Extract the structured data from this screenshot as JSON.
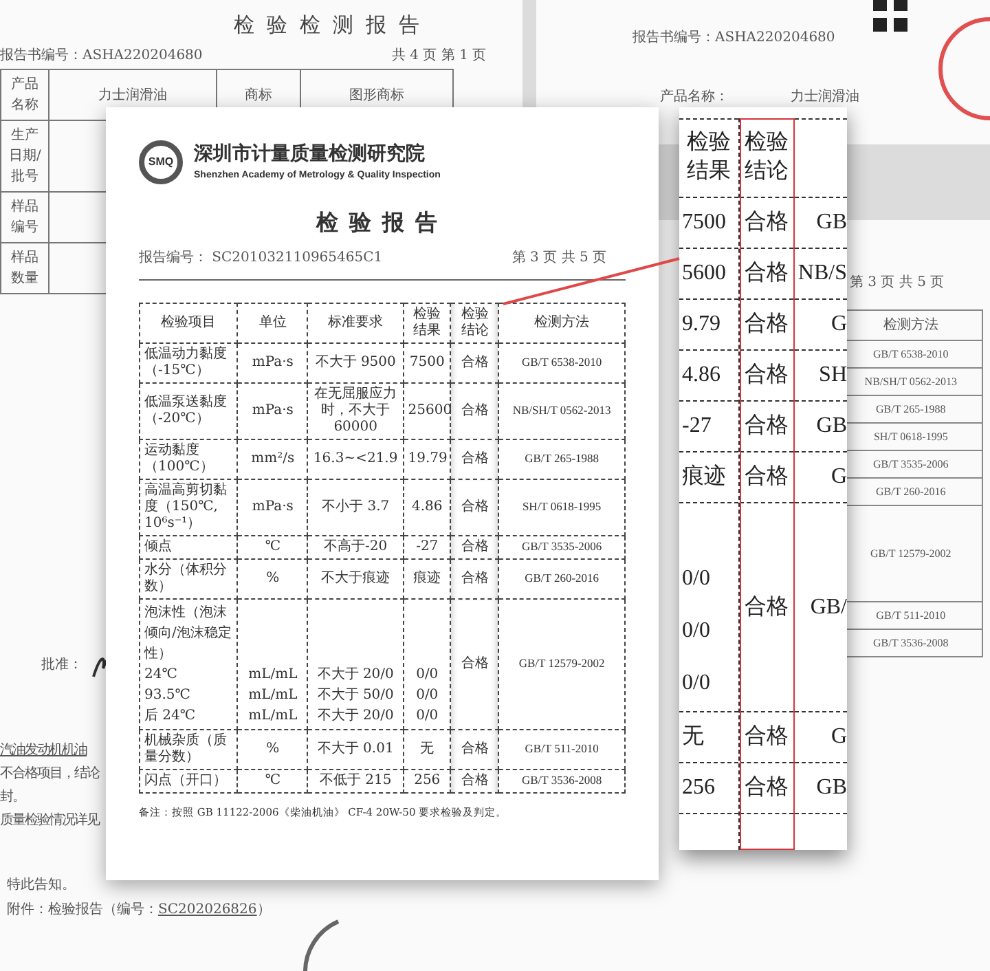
{
  "background_documents": {
    "top_left": {
      "title": "检验检测报告",
      "report_number": "报告书编号：ASHA220204680",
      "page_info": "共 4 页 第 1 页",
      "header_cells": [
        "产品名称",
        "力士润滑油",
        "商标",
        "图形商标"
      ],
      "row_labels": [
        "生产日期/批号",
        "样品编号",
        "样品数量"
      ]
    },
    "top_right": {
      "report_number": "报告书编号：ASHA220204680",
      "field_label": "产品名称：",
      "field_value": "力士润滑油"
    },
    "right_middle": {
      "page_info": "第 3 页 共 5 页",
      "column_heading": "检测方法",
      "methods": [
        "GB/T 6538-2010",
        "NB/SH/T 0562-2013",
        "GB/T 265-1988",
        "SH/T 0618-1995",
        "GB/T 3535-2006",
        "GB/T 260-2016",
        "GB/T 12579-2002",
        "GB/T 511-2010",
        "GB/T 3536-2008"
      ]
    },
    "bottom_left": {
      "label": "批准：",
      "lines": [
        "汽油发动机机油",
        "不合格项目，结论",
        "封。",
        "质量检验情况详见"
      ],
      "closing": "特此告知。",
      "attachment_label": "附件：检验报告（编号：",
      "attachment_number": "SC202026826",
      "attachment_suffix": "）"
    }
  },
  "main_report": {
    "logo_mark": "SMQ",
    "institute_name": "深圳市计量质量检测研究院",
    "institute_name_en": "Shenzhen Academy of Metrology & Quality Inspection",
    "title": "检验报告",
    "report_number_label": "报告编号：",
    "report_number": "SC201032110965465C1",
    "page_info": "第 3 页 共 5 页",
    "table": {
      "columns": [
        "检验项目",
        "单位",
        "标准要求",
        "检验结果",
        "检验结论",
        "检测方法"
      ],
      "rows": [
        {
          "kind": "single",
          "item": "低温动力黏度（-15℃）",
          "unit": "mPa·s",
          "requirement": "不大于 9500",
          "result": "7500",
          "conclusion": "合格",
          "method": "GB/T 6538-2010"
        },
        {
          "kind": "single",
          "item": "低温泵送黏度（-20℃）",
          "unit": "mPa·s",
          "requirement": "在无屈服应力时，不大于 60000",
          "result": "25600",
          "conclusion": "合格",
          "method": "NB/SH/T 0562-2013"
        },
        {
          "kind": "single",
          "item": "运动黏度（100℃）",
          "unit": "mm²/s",
          "requirement": "16.3~<21.9",
          "result": "19.79",
          "conclusion": "合格",
          "method": "GB/T 265-1988"
        },
        {
          "kind": "single",
          "item": "高温高剪切黏度（150℃, 10⁶s⁻¹）",
          "unit": "mPa·s",
          "requirement": "不小于 3.7",
          "result": "4.86",
          "conclusion": "合格",
          "method": "SH/T 0618-1995"
        },
        {
          "kind": "single",
          "item": "倾点",
          "unit": "℃",
          "requirement": "不高于-20",
          "result": "-27",
          "conclusion": "合格",
          "method": "GB/T 3535-2006"
        },
        {
          "kind": "single",
          "item": "水分（体积分数）",
          "unit": "%",
          "requirement": "不大于痕迹",
          "result": "痕迹",
          "conclusion": "合格",
          "method": "GB/T 260-2016"
        },
        {
          "kind": "group",
          "item": "泡沫性（泡沫倾向/泡沫稳定性）",
          "sub_rows": [
            {
              "item": "24℃",
              "unit": "mL/mL",
              "requirement": "不大于 20/0",
              "result": "0/0"
            },
            {
              "item": "93.5℃",
              "unit": "mL/mL",
              "requirement": "不大于 50/0",
              "result": "0/0"
            },
            {
              "item": "后 24℃",
              "unit": "mL/mL",
              "requirement": "不大于 20/0",
              "result": "0/0"
            }
          ],
          "conclusion": "合格",
          "method": "GB/T 12579-2002"
        },
        {
          "kind": "single",
          "item": "机械杂质（质量分数）",
          "unit": "%",
          "requirement": "不大于 0.01",
          "result": "无",
          "conclusion": "合格",
          "method": "GB/T 511-2010"
        },
        {
          "kind": "single",
          "item": "闪点（开口）",
          "unit": "℃",
          "requirement": "不低于 215",
          "result": "256",
          "conclusion": "合格",
          "method": "GB/T 3536-2008"
        }
      ]
    },
    "note": "备注：按照 GB 11122-2006《柴油机油》 CF-4 20W-50 要求检验及判定。"
  },
  "magnifier": {
    "columns": [
      {
        "label": "检验结果",
        "highlighted": false
      },
      {
        "label": "检验结论",
        "highlighted": true
      }
    ],
    "rows": [
      {
        "kind": "single",
        "result": "7500",
        "conclusion": "合格",
        "method": "GB"
      },
      {
        "kind": "single",
        "result": "5600",
        "conclusion": "合格",
        "method": "NB/S"
      },
      {
        "kind": "single",
        "result": "9.79",
        "conclusion": "合格",
        "method": "G"
      },
      {
        "kind": "single",
        "result": "4.86",
        "conclusion": "合格",
        "method": "SH"
      },
      {
        "kind": "single",
        "result": "-27",
        "conclusion": "合格",
        "method": "GB"
      },
      {
        "kind": "single",
        "result": "痕迹",
        "conclusion": "合格",
        "method": "G"
      },
      {
        "kind": "group",
        "results": [
          "0/0",
          "0/0",
          "0/0"
        ],
        "conclusion": "合格",
        "method": "GB/"
      },
      {
        "kind": "single",
        "result": "无",
        "conclusion": "合格",
        "method": "G"
      },
      {
        "kind": "single",
        "result": "256",
        "conclusion": "合格",
        "method": "GB"
      }
    ]
  }
}
